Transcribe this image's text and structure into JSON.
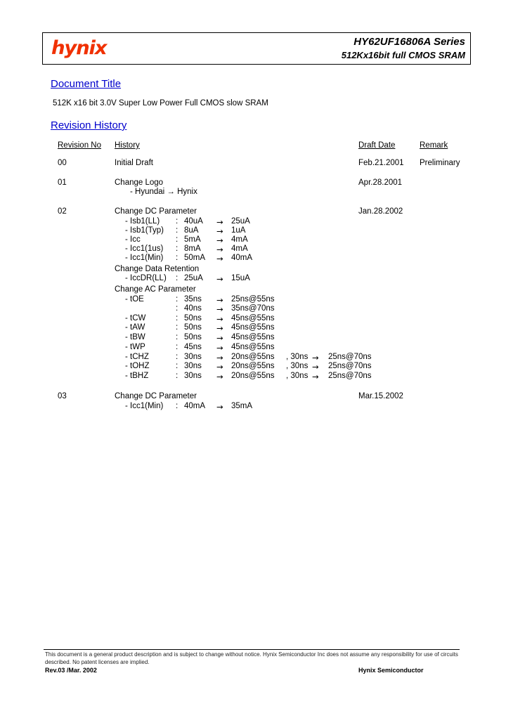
{
  "header": {
    "logo_text": "hynix",
    "logo_color": "#F03000",
    "series_title": "HY62UF16806A Series",
    "series_subtitle": "512Kx16bit full CMOS SRAM"
  },
  "sections": {
    "document_title_heading": "Document Title",
    "document_title_text": "512K x16 bit 3.0V Super Low Power Full CMOS slow SRAM",
    "revision_history_heading": "Revision History",
    "heading_color": "#0000CC"
  },
  "table": {
    "headers": {
      "revision_no": "Revision No",
      "history": "History",
      "draft_date": "Draft Date",
      "remark": "Remark"
    },
    "rows": [
      {
        "revision_no": "00",
        "history": "Initial Draft",
        "draft_date": "Feb.21.2001",
        "remark": "Preliminary"
      },
      {
        "revision_no": "01",
        "history": "Change Logo",
        "draft_date": "Apr.28.2001",
        "remark": "",
        "detail_line": "- Hyundai  →   Hynix"
      },
      {
        "revision_no": "02",
        "history": "Change DC Parameter",
        "draft_date": "Jan.28.2002",
        "remark": ""
      },
      {
        "revision_no": "03",
        "history": "Change DC Parameter",
        "draft_date": "Mar.15.2002",
        "remark": ""
      }
    ]
  },
  "rev02": {
    "dc_params": [
      {
        "name": "- Isb1(LL)",
        "colon": ":",
        "from": "40uA",
        "arrow": "→",
        "to": "25uA"
      },
      {
        "name": "- Isb1(Typ)",
        "colon": ":",
        "from": "8uA",
        "arrow": "→",
        "to": "1uA"
      },
      {
        "name": "- Icc",
        "colon": ":",
        "from": "5mA",
        "arrow": "→",
        "to": "4mA"
      },
      {
        "name": "- Icc1(1us)",
        "colon": ":",
        "from": "8mA",
        "arrow": "→",
        "to": "4mA"
      },
      {
        "name": "- Icc1(Min)",
        "colon": ":",
        "from": "50mA",
        "arrow": "→",
        "to": "40mA"
      }
    ],
    "data_retention_heading": "Change Data Retention",
    "data_retention_params": [
      {
        "name": "- IccDR(LL)",
        "colon": ":",
        "from": "25uA",
        "arrow": "→",
        "to": "15uA"
      }
    ],
    "ac_heading": "Change AC Parameter",
    "ac_params": [
      {
        "name": "- tOE",
        "colon": ":",
        "from": "35ns",
        "arrow": "→",
        "to": "25ns@55ns",
        "extra": "",
        "arrow2": "",
        "to2": ""
      },
      {
        "name": "",
        "colon": ":",
        "from": "40ns",
        "arrow": "→",
        "to": "35ns@70ns",
        "extra": "",
        "arrow2": "",
        "to2": ""
      },
      {
        "name": "- tCW",
        "colon": ":",
        "from": "50ns",
        "arrow": "→",
        "to": "45ns@55ns",
        "extra": "",
        "arrow2": "",
        "to2": ""
      },
      {
        "name": "- tAW",
        "colon": ":",
        "from": "50ns",
        "arrow": "→",
        "to": "45ns@55ns",
        "extra": "",
        "arrow2": "",
        "to2": ""
      },
      {
        "name": "- tBW",
        "colon": ":",
        "from": "50ns",
        "arrow": "→",
        "to": "45ns@55ns",
        "extra": "",
        "arrow2": "",
        "to2": ""
      },
      {
        "name": "- tWP",
        "colon": ":",
        "from": "45ns",
        "arrow": "→",
        "to": "45ns@55ns",
        "extra": "",
        "arrow2": "",
        "to2": ""
      },
      {
        "name": "- tCHZ",
        "colon": ":",
        "from": "30ns",
        "arrow": "→",
        "to": "20ns@55ns",
        "extra": ", 30ns",
        "arrow2": "→",
        "to2": "25ns@70ns"
      },
      {
        "name": "- tOHZ",
        "colon": ":",
        "from": "30ns",
        "arrow": "→",
        "to": "20ns@55ns",
        "extra": ", 30ns",
        "arrow2": "→",
        "to2": "25ns@70ns"
      },
      {
        "name": "- tBHZ",
        "colon": ":",
        "from": "30ns",
        "arrow": "→",
        "to": "20ns@55ns",
        "extra": ", 30ns",
        "arrow2": "→",
        "to2": "25ns@70ns"
      }
    ]
  },
  "rev03": {
    "dc_params": [
      {
        "name": "- Icc1(Min)",
        "colon": ":",
        "from": "40mA",
        "arrow": "→",
        "to": "35mA"
      }
    ]
  },
  "footer": {
    "disclaimer": "This document is a general product description and is subject to change without notice. Hynix Semiconductor Inc does not  assume any responsibility for use of circuits described. No patent licenses are implied.",
    "revision": "Rev.03 /Mar. 2002",
    "company": "Hynix Semiconductor"
  }
}
